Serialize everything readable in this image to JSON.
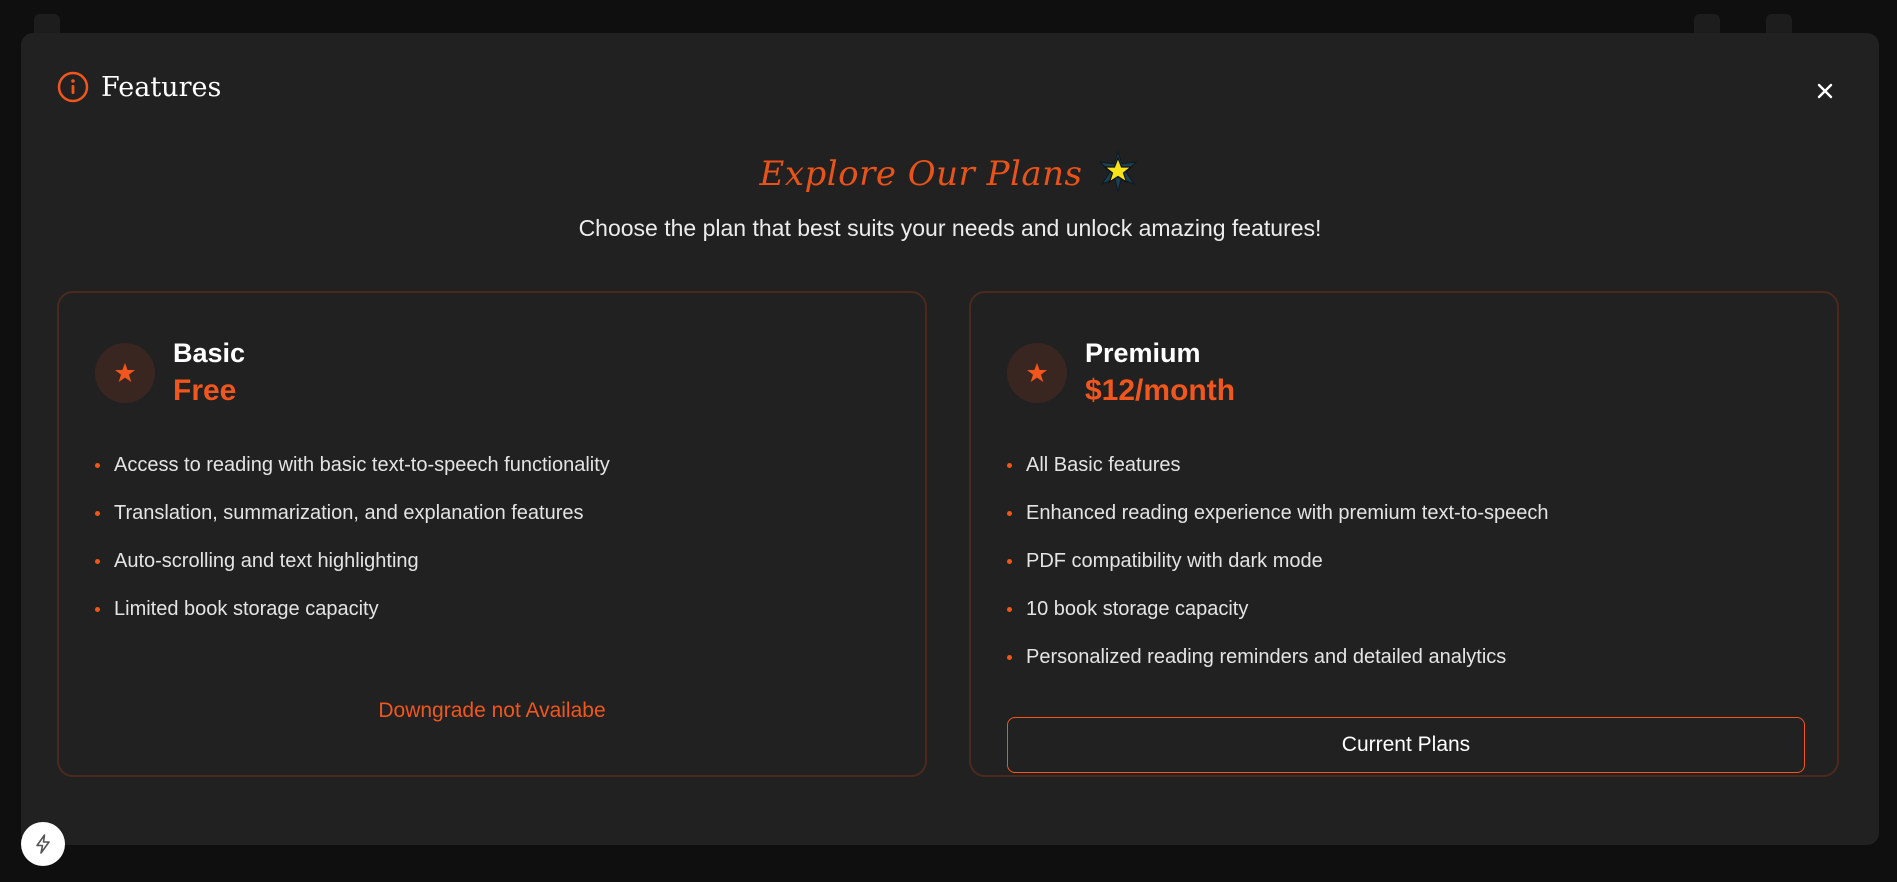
{
  "modal": {
    "title": "Features",
    "icons": {
      "header": "info-icon",
      "close": "close-icon"
    }
  },
  "hero": {
    "title": "Explore Our Plans",
    "emoji": "star-icon",
    "subtitle": "Choose the plan that best suits your needs and unlock amazing features!"
  },
  "plans": [
    {
      "name": "Basic",
      "price": "Free",
      "icon": "star-icon",
      "features": [
        "Access to reading with basic text-to-speech functionality",
        "Translation, summarization, and explanation features",
        "Auto-scrolling and text highlighting",
        "Limited book storage capacity"
      ],
      "action_label": "Downgrade not Availabe"
    },
    {
      "name": "Premium",
      "price": "$12/month",
      "icon": "star-icon",
      "features": [
        "All Basic features",
        "Enhanced reading experience with premium text-to-speech",
        "PDF compatibility with dark mode",
        "10 book storage capacity",
        "Personalized reading reminders and detailed analytics"
      ],
      "action_label": "Current Plans"
    }
  ],
  "colors": {
    "accent": "#f0561d",
    "modal_bg": "#212121",
    "card_border": "#4a2a1e",
    "page_bg": "#0f0f0f"
  },
  "fab": {
    "icon": "lightning-icon"
  }
}
